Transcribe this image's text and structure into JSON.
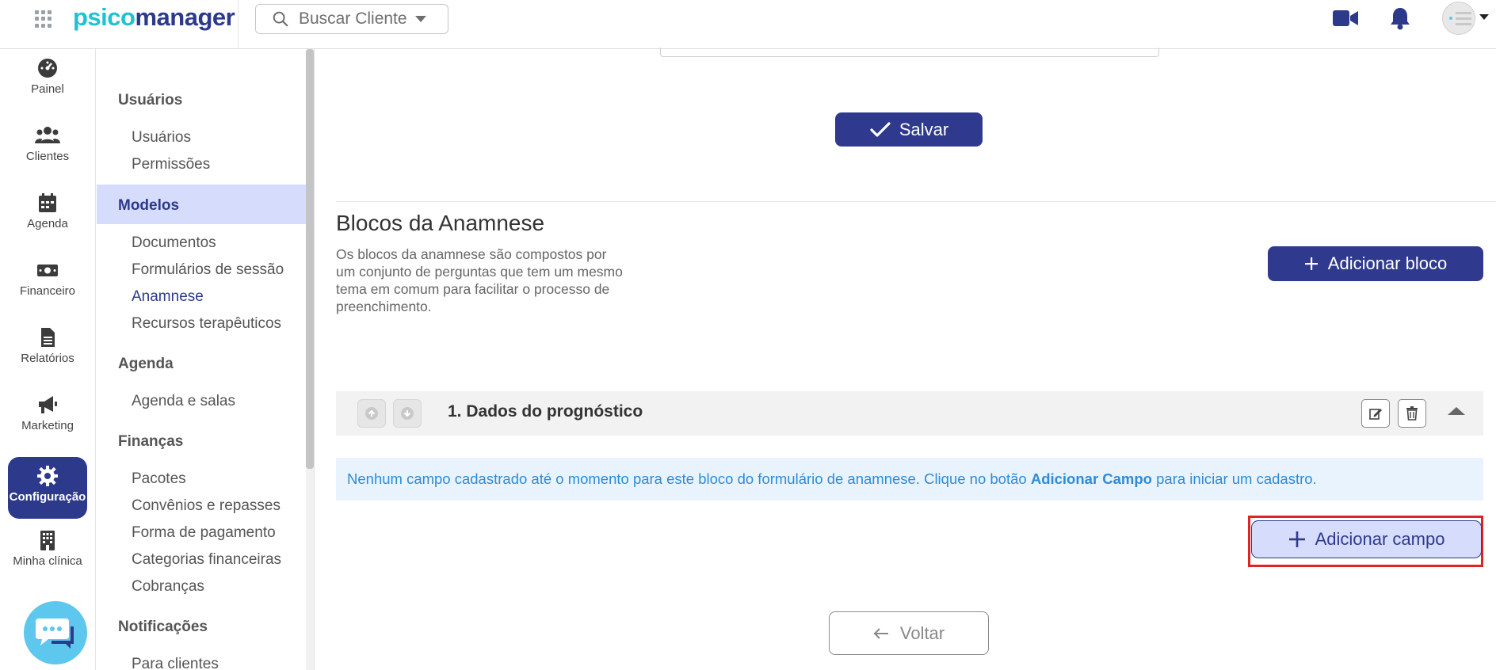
{
  "topbar": {
    "logo_part1": "psico",
    "logo_part2": "manager",
    "search_placeholder": "Buscar Cliente",
    "icons": [
      "apps-grid-icon",
      "video-camera-icon",
      "bell-icon",
      "avatar"
    ]
  },
  "rail": {
    "items": [
      {
        "label": "Painel",
        "icon": "dashboard-gauge-icon"
      },
      {
        "label": "Clientes",
        "icon": "users-icon"
      },
      {
        "label": "Agenda",
        "icon": "calendar-icon"
      },
      {
        "label": "Financeiro",
        "icon": "money-icon"
      },
      {
        "label": "Relatórios",
        "icon": "document-icon"
      },
      {
        "label": "Marketing",
        "icon": "megaphone-icon"
      },
      {
        "label": "Configuração",
        "icon": "gear-icon",
        "active": true
      },
      {
        "label": "Minha clínica",
        "icon": "building-icon"
      }
    ],
    "chat_icon": "chat-bubble-icon"
  },
  "submenu": {
    "sections": [
      {
        "title": "Usuários",
        "links": [
          "Usuários",
          "Permissões"
        ]
      },
      {
        "title": "Modelos",
        "active": true,
        "links": [
          "Documentos",
          "Formulários de sessão",
          "Anamnese",
          "Recursos terapêuticos"
        ],
        "active_link": "Anamnese"
      },
      {
        "title": "Agenda",
        "links": [
          "Agenda e salas"
        ]
      },
      {
        "title": "Finanças",
        "links": [
          "Pacotes",
          "Convênios e repasses",
          "Forma de pagamento",
          "Categorias financeiras",
          "Cobranças"
        ]
      },
      {
        "title": "Notificações",
        "links": [
          "Para clientes"
        ]
      }
    ]
  },
  "main": {
    "save_label": "Salvar",
    "blocks_title": "Blocos da Anamnese",
    "blocks_desc": "Os blocos da anamnese são compostos por um conjunto de perguntas que tem um mesmo tema em comum para facilitar o processo de preenchimento.",
    "add_block_label": "Adicionar bloco",
    "block": {
      "title": "1. Dados do prognóstico"
    },
    "alert_before": "Nenhum campo cadastrado até o momento para este bloco do formulário de anamnese. Clique no botão ",
    "alert_bold": "Adicionar Campo",
    "alert_after": " para iniciar um cadastro.",
    "add_field_label": "Adicionar campo",
    "back_label": "Voltar"
  },
  "colors": {
    "primary": "#2f3a8f",
    "accent_light": "#d6dcfb",
    "info_bg": "#e9f3fd",
    "info_text": "#2d8bd8",
    "highlight": "#e02424",
    "logo_cyan": "#1fc3cf"
  }
}
